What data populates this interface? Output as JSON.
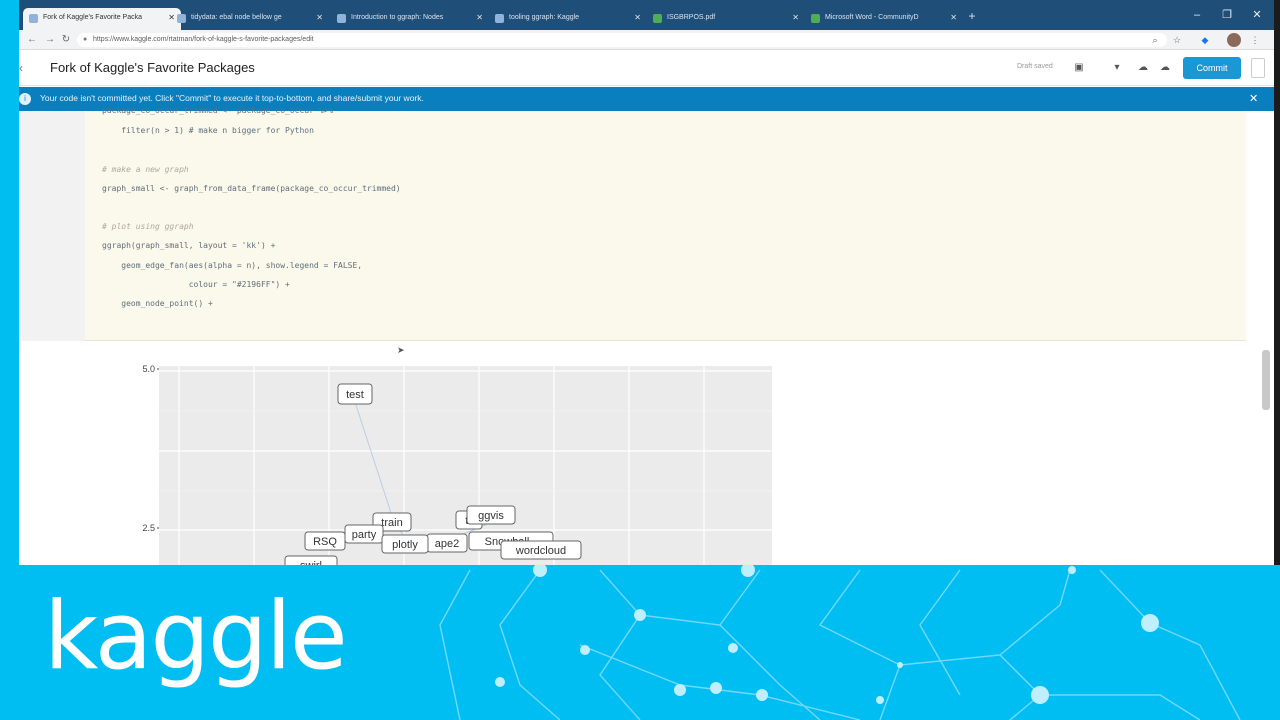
{
  "browser": {
    "tabs": [
      {
        "label": "Fork of Kaggle's Favorite Packa"
      },
      {
        "label": "tidydata: ebal node bellow ge"
      },
      {
        "label": "Introduction to ggraph: Nodes"
      },
      {
        "label": "tooling ggraph: Kaggle"
      },
      {
        "label": "ISGBRPOS.pdf"
      },
      {
        "label": "Microsoft Word - CommunityD"
      }
    ],
    "url": "https://www.kaggle.com/rtatman/fork-of-kaggle-s-favorite-packages/edit",
    "new_tab_glyph": "+",
    "window_controls": [
      "–",
      "❐",
      "✕"
    ]
  },
  "header": {
    "title": "Fork of Kaggle's Favorite Packages",
    "draft_status": "Draft saved",
    "commit_label": "Commit"
  },
  "notice": {
    "text": "Your code isn't committed yet. Click \"Commit\" to execute it top-to-bottom, and share/submit your work.",
    "close_glyph": "✕"
  },
  "code": {
    "lines": [
      {
        "text": "package_co_occur_trimmed <- package_co_occur %>%",
        "kind": "code"
      },
      {
        "text": "    filter(n > 1) # make n bigger for Python",
        "kind": "code"
      },
      {
        "text": "# make a new graph",
        "kind": "comment"
      },
      {
        "text": "graph_small <- graph_from_data_frame(package_co_occur_trimmed)",
        "kind": "code"
      },
      {
        "text": "# plot using ggraph",
        "kind": "comment"
      },
      {
        "text": "ggraph(graph_small, layout = 'kk') +",
        "kind": "code"
      },
      {
        "text": "    geom_edge_fan(aes(alpha = n), show.legend = FALSE,",
        "kind": "code"
      },
      {
        "text": "                  colour = \"#2196FF\") +",
        "kind": "code"
      },
      {
        "text": "    geom_node_point() +",
        "kind": "code"
      }
    ]
  },
  "plot": {
    "y_ticks": [
      "5.0",
      "2.5"
    ],
    "node_labels": [
      "test",
      "train",
      "party",
      "RSQ",
      "plotly",
      "ape2",
      "ggvis",
      "ti",
      "Snowball",
      "wordcloud",
      "swirl"
    ]
  },
  "banner": {
    "brand": "kaggle"
  },
  "colors": {
    "kaggle_blue": "#00bdf2",
    "notice_blue": "#0a7fbf",
    "commit_blue": "#1a98d6"
  }
}
